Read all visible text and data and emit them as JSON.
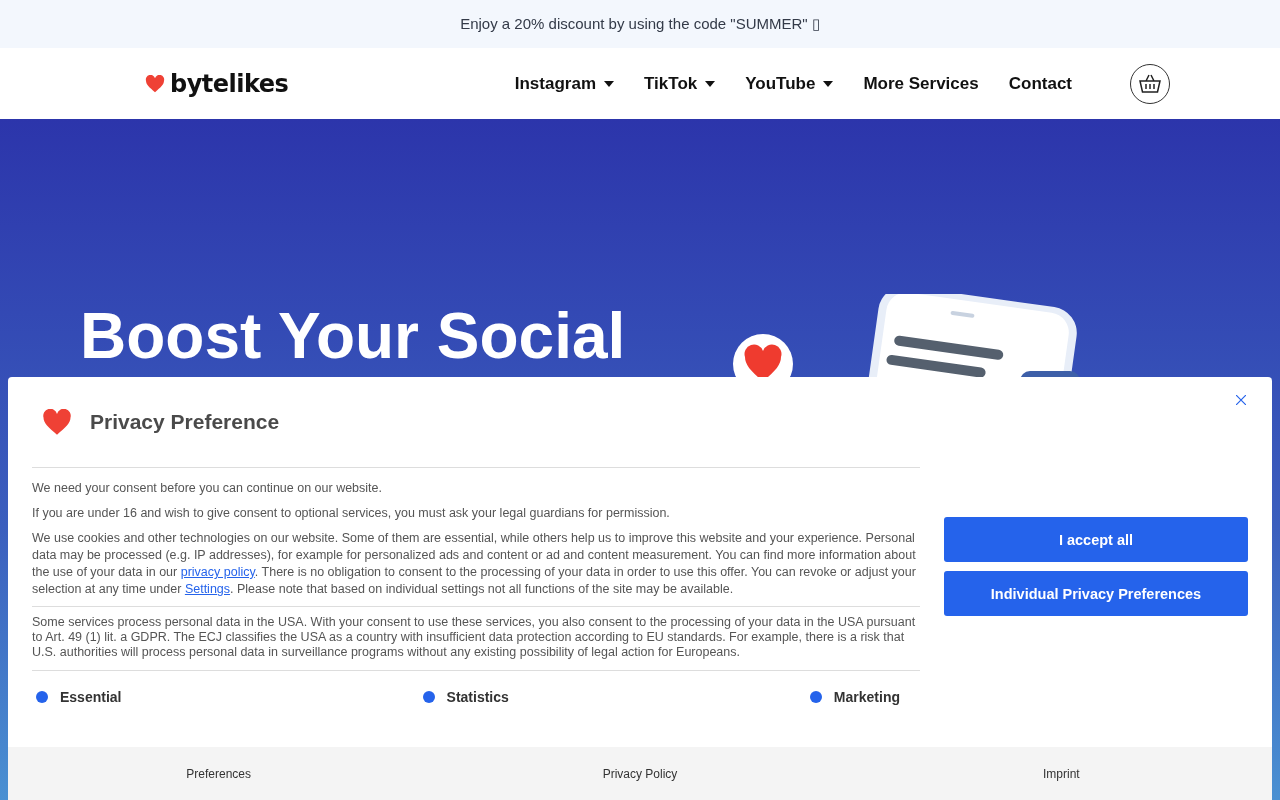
{
  "promo_bar": {
    "text": "Enjoy a 20% discount by using the code \"SUMMER\" ▯"
  },
  "header": {
    "logo": "bytelikes",
    "nav": [
      {
        "label": "Instagram",
        "kind": "dropdown"
      },
      {
        "label": "TikTok",
        "kind": "dropdown"
      },
      {
        "label": "YouTube",
        "kind": "dropdown"
      },
      {
        "label": "More Services",
        "kind": "link"
      },
      {
        "label": "Contact",
        "kind": "link"
      }
    ]
  },
  "hero": {
    "title": "Boost Your Social"
  },
  "privacy_dialog": {
    "title": "Privacy Preference",
    "paragraphs": [
      "We need your consent before you can continue on our website.",
      "If you are under 16 and wish to give consent to optional services, you must ask your legal guardians for permission.",
      [
        {
          "kind": "text",
          "text": "We use cookies and other technologies on our website. Some of them are essential, while others help us to improve this website and your experience. Personal data may be processed (e.g. IP addresses), for example for personalized ads and content or ad and content measurement. You can find more information about the use of your data in our "
        },
        {
          "kind": "link",
          "text": "privacy policy"
        },
        {
          "kind": "text",
          "text": ". There is no obligation to consent to the processing of your data in order to use this offer. You can revoke or adjust your selection at any time under "
        },
        {
          "kind": "link",
          "text": "Settings"
        },
        {
          "kind": "text",
          "text": ". Please note that based on individual settings not all functions of the site may be available."
        }
      ]
    ],
    "usa_notice": "Some services process personal data in the USA. With your consent to use these services, you also consent to the processing of your data in the USA pursuant to Art. 49 (1) lit. a GDPR. The ECJ classifies the USA as a country with insufficient data protection according to EU standards. For example, there is a risk that U.S. authorities will process personal data in surveillance programs without any existing possibility of legal action for Europeans.",
    "groups": [
      "Essential",
      "Statistics",
      "Marketing"
    ],
    "buttons": [
      "I accept all",
      "Individual Privacy Preferences"
    ],
    "footer_links": [
      "Preferences",
      "Privacy Policy",
      "Imprint"
    ]
  }
}
